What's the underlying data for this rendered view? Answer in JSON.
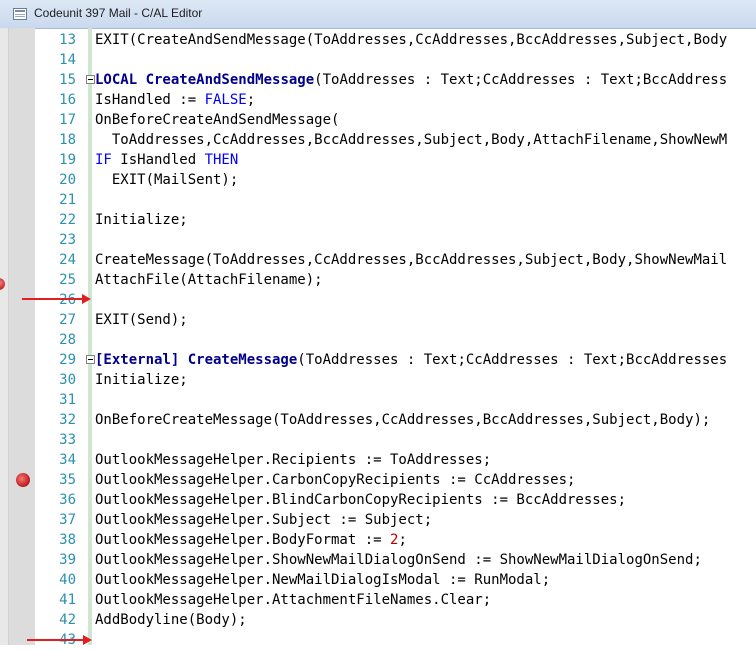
{
  "window": {
    "title": "Codeunit 397 Mail - C/AL Editor"
  },
  "colors": {
    "keyword": "#0000ff",
    "identifier": "#00008b",
    "line_number": "#2b91af",
    "breakpoint": "#c62424",
    "arrow": "#e02020"
  },
  "code": {
    "lines": [
      {
        "n": "13",
        "t": "EXIT(CreateAndSendMessage(ToAddresses,CcAddresses,BccAddresses,Subject,Body"
      },
      {
        "n": "14",
        "t": ""
      },
      {
        "n": "15",
        "kw1": "LOCAL ",
        "id": "CreateAndSendMessage",
        "rest": "(ToAddresses : Text;CcAddresses : Text;BccAddress"
      },
      {
        "n": "16",
        "t": "IsHandled := ",
        "kw": "FALSE",
        "t2": ";"
      },
      {
        "n": "17",
        "t": "OnBeforeCreateAndSendMessage("
      },
      {
        "n": "18",
        "t": "  ToAddresses,CcAddresses,BccAddresses,Subject,Body,AttachFilename,ShowNewM"
      },
      {
        "n": "19",
        "kw": "IF",
        "t": " IsHandled ",
        "kw2": "THEN"
      },
      {
        "n": "20",
        "t": "  EXIT(MailSent);"
      },
      {
        "n": "21",
        "t": ""
      },
      {
        "n": "22",
        "t": "Initialize;"
      },
      {
        "n": "23",
        "t": ""
      },
      {
        "n": "24",
        "t": "CreateMessage(ToAddresses,CcAddresses,BccAddresses,Subject,Body,ShowNewMail"
      },
      {
        "n": "25",
        "t": "AttachFile(AttachFilename);"
      },
      {
        "n": "26",
        "t": ""
      },
      {
        "n": "27",
        "t": "EXIT(Send);"
      },
      {
        "n": "28",
        "t": ""
      },
      {
        "n": "29",
        "kw1": "[External] ",
        "id": "CreateMessage",
        "rest": "(ToAddresses : Text;CcAddresses : Text;BccAddresses"
      },
      {
        "n": "30",
        "t": "Initialize;"
      },
      {
        "n": "31",
        "t": ""
      },
      {
        "n": "32",
        "t": "OnBeforeCreateMessage(ToAddresses,CcAddresses,BccAddresses,Subject,Body);"
      },
      {
        "n": "33",
        "t": ""
      },
      {
        "n": "34",
        "t": "OutlookMessageHelper.Recipients := ToAddresses;"
      },
      {
        "n": "35",
        "t": "OutlookMessageHelper.CarbonCopyRecipients := CcAddresses;"
      },
      {
        "n": "36",
        "t": "OutlookMessageHelper.BlindCarbonCopyRecipients := BccAddresses;"
      },
      {
        "n": "37",
        "t": "OutlookMessageHelper.Subject := Subject;"
      },
      {
        "n": "38",
        "t": "OutlookMessageHelper.BodyFormat := ",
        "num": "2",
        "t2": ";"
      },
      {
        "n": "39",
        "t": "OutlookMessageHelper.ShowNewMailDialogOnSend := ShowNewMailDialogOnSend;"
      },
      {
        "n": "40",
        "t": "OutlookMessageHelper.NewMailDialogIsModal := RunModal;"
      },
      {
        "n": "41",
        "t": "OutlookMessageHelper.AttachmentFileNames.Clear;"
      },
      {
        "n": "42",
        "t": "AddBodyline(Body);"
      },
      {
        "n": "43",
        "t": ""
      }
    ]
  }
}
